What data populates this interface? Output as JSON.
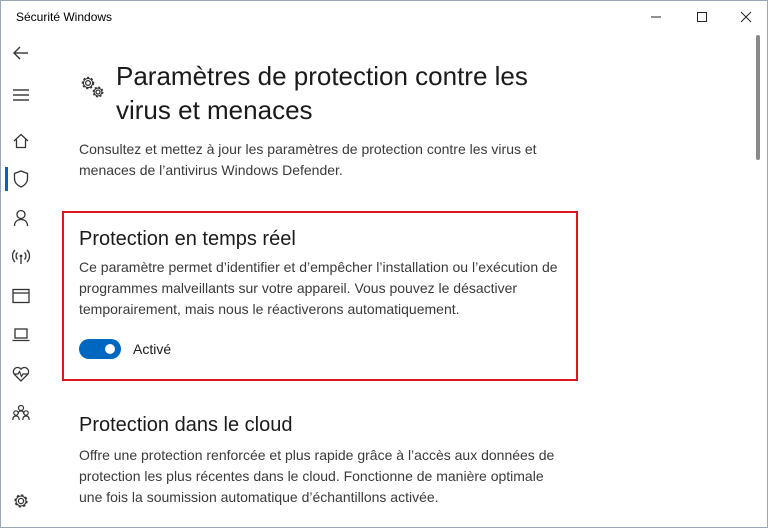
{
  "window": {
    "title": "Sécurité Windows",
    "controls": {
      "minimize_icon": "minimize-icon",
      "maximize_icon": "maximize-icon",
      "close_icon": "close-icon"
    }
  },
  "nav": {
    "items": [
      {
        "icon": "back-arrow-icon"
      },
      {
        "icon": "hamburger-menu-icon"
      },
      {
        "icon": "home-icon"
      },
      {
        "icon": "shield-icon",
        "active": true
      },
      {
        "icon": "person-icon"
      },
      {
        "icon": "wireless-icon"
      },
      {
        "icon": "app-browser-icon"
      },
      {
        "icon": "laptop-icon"
      },
      {
        "icon": "heart-pulse-icon"
      },
      {
        "icon": "family-icon"
      },
      {
        "icon": "settings-gear-icon"
      }
    ],
    "accent_color": "#0067c0"
  },
  "main": {
    "title": "Paramètres de protection contre les virus et menaces",
    "description": "Consultez et mettez à jour les paramètres de protection contre les virus et menaces de l’antivirus Windows Defender.",
    "sections": [
      {
        "title": "Protection en temps réel",
        "description": "Ce paramètre permet d’identifier et d’empêcher l’installation ou l’exécution de programmes malveillants sur votre appareil. Vous pouvez le désactiver temporairement, mais nous le réactiverons automatiquement.",
        "toggle": {
          "state": "on",
          "label": "Activé"
        },
        "highlighted": true,
        "highlight_color": "#e0141c"
      },
      {
        "title": "Protection dans le cloud",
        "description": "Offre une protection renforcée et plus rapide grâce à l’accès aux données de protection les plus récentes dans le cloud. Fonctionne de manière optimale une fois la soumission automatique d’échantillons activée."
      }
    ]
  }
}
